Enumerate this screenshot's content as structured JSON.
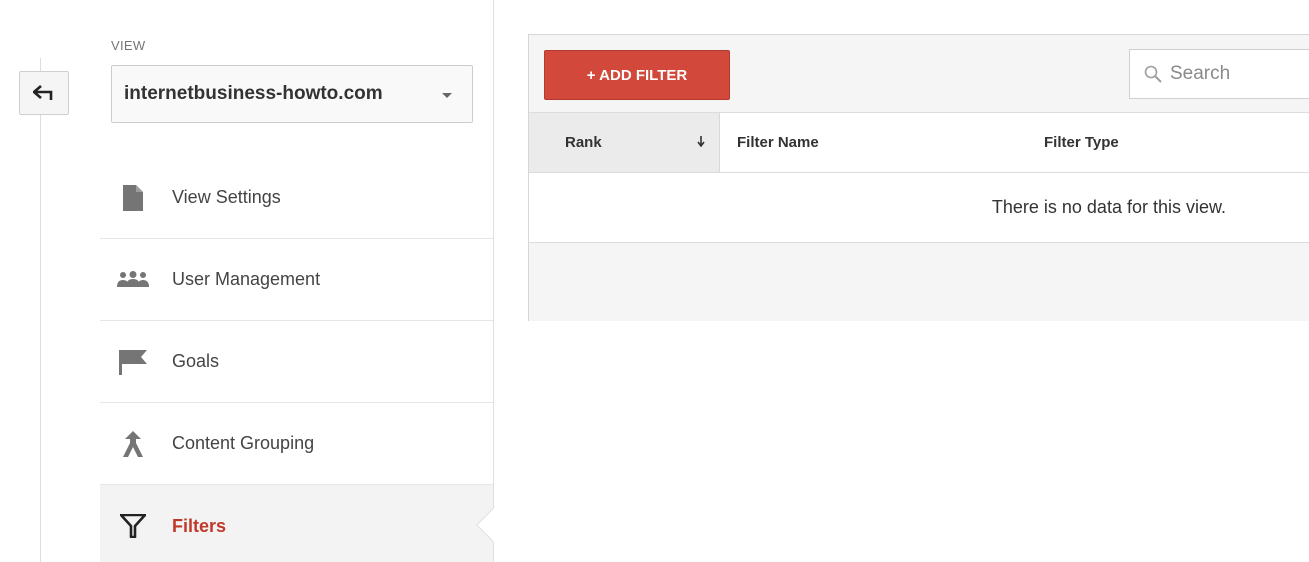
{
  "back_button": {
    "icon": "back-arrow-icon"
  },
  "view_selector": {
    "label": "VIEW",
    "selected": "internetbusiness-howto.com"
  },
  "nav": {
    "items": [
      {
        "label": "View Settings",
        "icon": "document-icon",
        "active": false
      },
      {
        "label": "User Management",
        "icon": "users-icon",
        "active": false
      },
      {
        "label": "Goals",
        "icon": "flag-icon",
        "active": false
      },
      {
        "label": "Content Grouping",
        "icon": "content-grouping-icon",
        "active": false
      },
      {
        "label": "Filters",
        "icon": "filter-icon",
        "active": true
      }
    ]
  },
  "toolbar": {
    "add_filter_label": "+ ADD FILTER",
    "search_placeholder": "Search"
  },
  "table": {
    "columns": [
      "Rank",
      "Filter Name",
      "Filter Type"
    ],
    "empty_message": "There is no data for this view."
  },
  "colors": {
    "accent": "#d2483a",
    "active_text": "#c0392b"
  }
}
